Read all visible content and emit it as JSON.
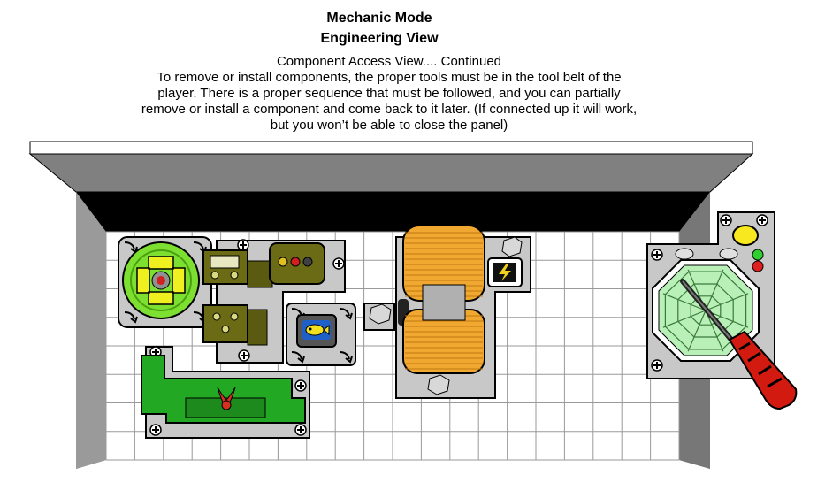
{
  "header": {
    "mode_title": "Mechanic Mode",
    "view_title": "Engineering View"
  },
  "description": {
    "heading": "Component Access View.... Continued",
    "lines": [
      "To remove or install components, the proper tools must be in the tool belt of the",
      "player. There is a proper sequence that must be followed, and you can partially",
      "remove or install a component and come back to it later. (If connected up it will work,",
      "but you won’t be able to close the panel)"
    ]
  },
  "colors": {
    "grid_line": "#9a9a9a",
    "component_plate": "#c8c8c8",
    "fan_green": "#7de030",
    "connector_olive": "#6b6b16",
    "green_board": "#23a823",
    "coil_orange": "#f0a830",
    "radar_green": "#b8f0b8",
    "screwdriver_handle": "#d21a10",
    "indicator_yellow": "#f8e820",
    "indicator_green": "#30d030",
    "indicator_red": "#e02020"
  },
  "icons": {
    "fan": "fan-icon",
    "blue_emblem": "fish-emblem-icon",
    "red_emblem": "bird-emblem-icon",
    "warning": "lightning-warning-icon",
    "tool": "screwdriver-icon"
  }
}
